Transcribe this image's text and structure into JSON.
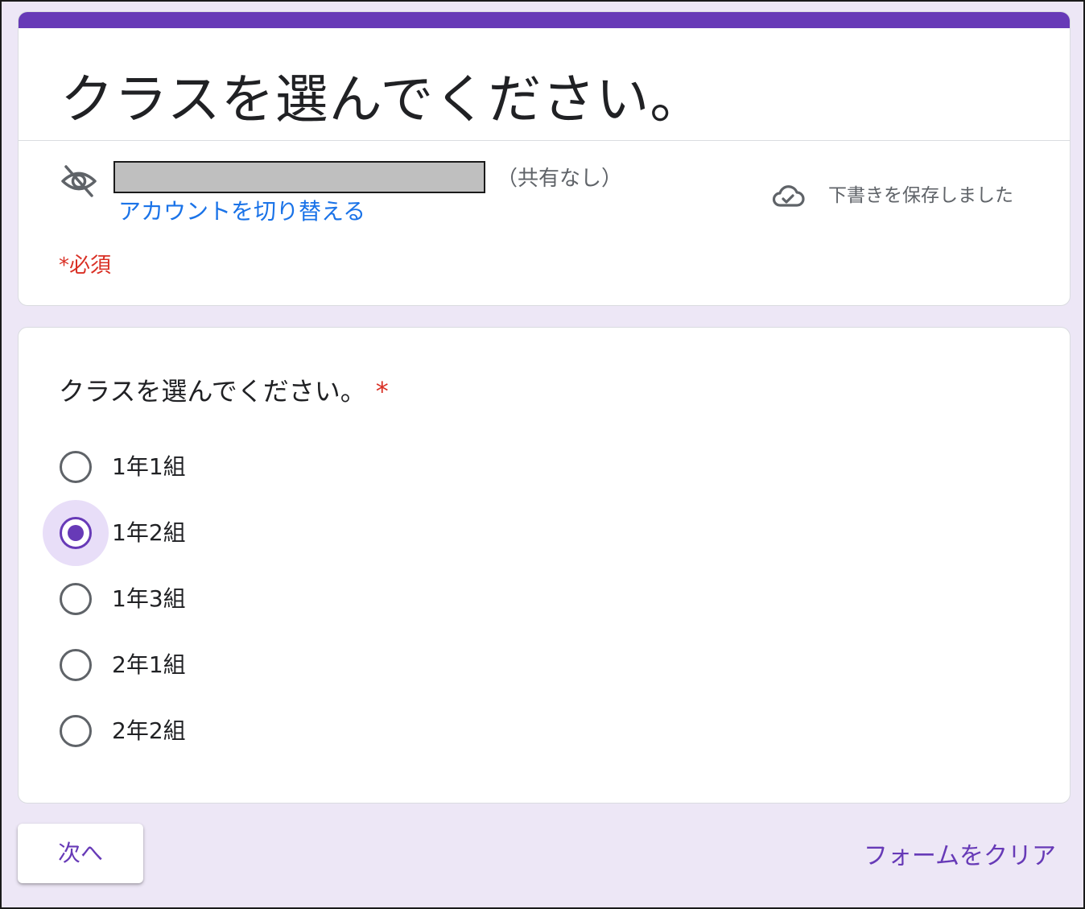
{
  "header": {
    "title": "クラスを選んでください。",
    "share_status": "（共有なし）",
    "switch_account": "アカウントを切り替える",
    "draft_status": "下書きを保存しました",
    "required_note": "*必須"
  },
  "question": {
    "title": "クラスを選んでください。",
    "required_star": "*",
    "selected_index": 1,
    "options": [
      {
        "label": "1年1組"
      },
      {
        "label": "1年2組"
      },
      {
        "label": "1年3組"
      },
      {
        "label": "2年1組"
      },
      {
        "label": "2年2組"
      }
    ]
  },
  "footer": {
    "next_label": "次へ",
    "clear_label": "フォームをクリア"
  },
  "colors": {
    "accent": "#673ab7",
    "background": "#ede7f6",
    "link": "#1a73e8",
    "required": "#d93025"
  },
  "icons": {
    "visibility": "eye-off-icon",
    "saved": "cloud-check-icon"
  }
}
